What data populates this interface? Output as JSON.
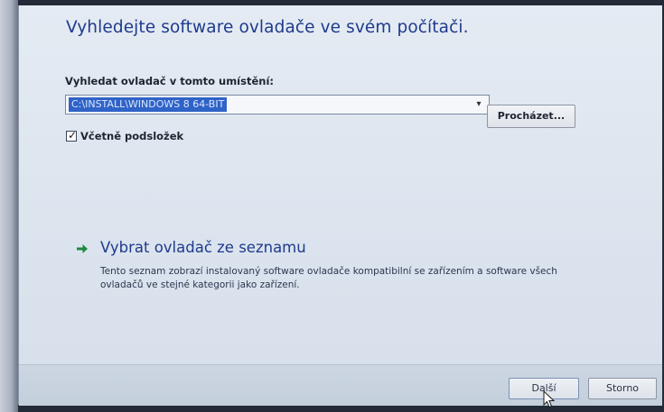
{
  "dialog": {
    "heading": "Vyhledejte software ovladače ve svém počítači.",
    "search_location": {
      "label": "Vyhledat ovladač v tomto umístění:",
      "value": "C:\\INSTALL\\WINDOWS 8 64-BIT",
      "browse_label": "Procházet..."
    },
    "include_subfolders": {
      "label": "Včetně podsložek",
      "checked": true
    },
    "pick_from_list": {
      "title": "Vybrat ovladač ze seznamu",
      "description": "Tento seznam zobrazí instalovaný software ovladače kompatibilní se zařízením a software všech ovladačů ve stejné kategorii jako zařízení."
    },
    "footer": {
      "next_label": "Další",
      "cancel_label": "Storno"
    }
  },
  "icons": {
    "dropdown": "chevron-down-icon",
    "link_arrow": "arrow-right-icon",
    "checkbox": "checkmark-icon",
    "cursor": "mouse-pointer-icon"
  },
  "colors": {
    "heading": "#1f3a8c",
    "selection": "#2f63c7",
    "link_arrow": "#1f8a3a"
  }
}
